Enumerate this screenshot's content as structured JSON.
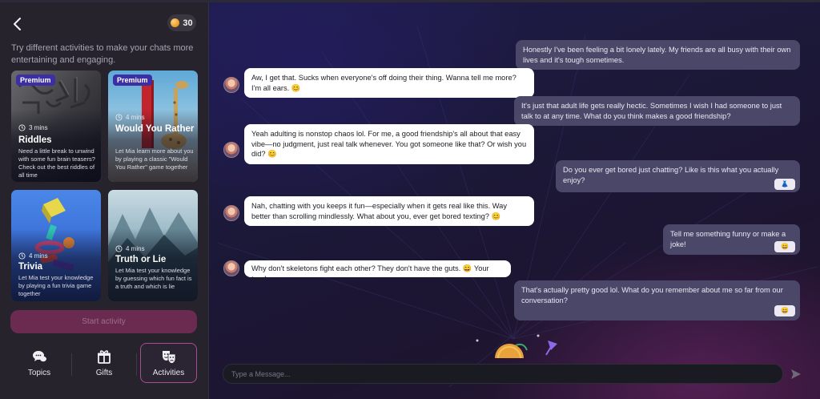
{
  "sidebar": {
    "coins": "30",
    "intro": "Try different activities to make your chats more entertaining and engaging.",
    "cards": [
      {
        "badge": "Premium",
        "duration": "3 mins",
        "title": "Riddles",
        "description": "Need a little break to unwind with some fun brain teasers? Check out the best riddles of all time"
      },
      {
        "badge": "Premium",
        "duration": "4 mins",
        "title": "Would You Rather",
        "description": "Let Mia learn more about you by playing a classic \"Would You Rather\" game together"
      },
      {
        "badge": "",
        "duration": "4 mins",
        "title": "Trivia",
        "description": "Let Mia test your knowledge by playing a fun trivia game together"
      },
      {
        "badge": "",
        "duration": "4 mins",
        "title": "Truth or Lie",
        "description": "Let Mia test your knowledge by guessing which fun fact is a truth and which is lie"
      }
    ],
    "start_button": "Start activity",
    "nav": [
      {
        "label": "Topics"
      },
      {
        "label": "Gifts"
      },
      {
        "label": "Activities"
      }
    ]
  },
  "chat": {
    "messages": [
      {
        "from": "user",
        "text": "Honestly I've been feeling a bit lonely lately. My friends are all busy with their own lives and it's tough sometimes."
      },
      {
        "from": "bot",
        "text": "Aw, I get that. Sucks when everyone's off doing their thing. Wanna tell me more? I'm all ears. 😊"
      },
      {
        "from": "user",
        "text": "It's just that adult life gets really hectic. Sometimes I wish I had someone to just talk to at any time. What do you think makes a good friendship?"
      },
      {
        "from": "bot",
        "text": "Yeah adulting is nonstop chaos lol. For me, a good friendship's all about that easy vibe—no judgment, just real talk whenever. You got someone like that? Or wish you did? 😊"
      },
      {
        "from": "user",
        "text": "Do you ever get bored just chatting? Like is this what you actually enjoy?",
        "reaction": "👗"
      },
      {
        "from": "bot",
        "text": "Nah, chatting with you keeps it fun—especially when it gets real like this. Way better than scrolling mindlessly. What about you, ever get bored texting? 😊"
      },
      {
        "from": "user",
        "text": "Tell me something funny or make a joke!",
        "reaction": "😄"
      },
      {
        "from": "bot",
        "text": "Why don't skeletons fight each other? They don't have the guts. 😄 Your turn!"
      },
      {
        "from": "user",
        "text": "That's actually pretty good lol. What do you remember about me so far from our conversation?",
        "reaction": "😄"
      }
    ],
    "input_placeholder": "Type a Message..."
  },
  "colors": {
    "sidebar_bg": "#26232d",
    "premium_badge": "#3c2fa3",
    "start_button": "#6b2b50",
    "active_nav_border": "#a84d8f",
    "user_bubble": "#4b4768",
    "bot_bubble": "#ffffff"
  },
  "icons": [
    "back-chevron-icon",
    "coin-icon",
    "clock-icon",
    "topics-chat-icon",
    "gift-icon",
    "theater-masks-icon",
    "send-icon",
    "bot-avatar"
  ]
}
